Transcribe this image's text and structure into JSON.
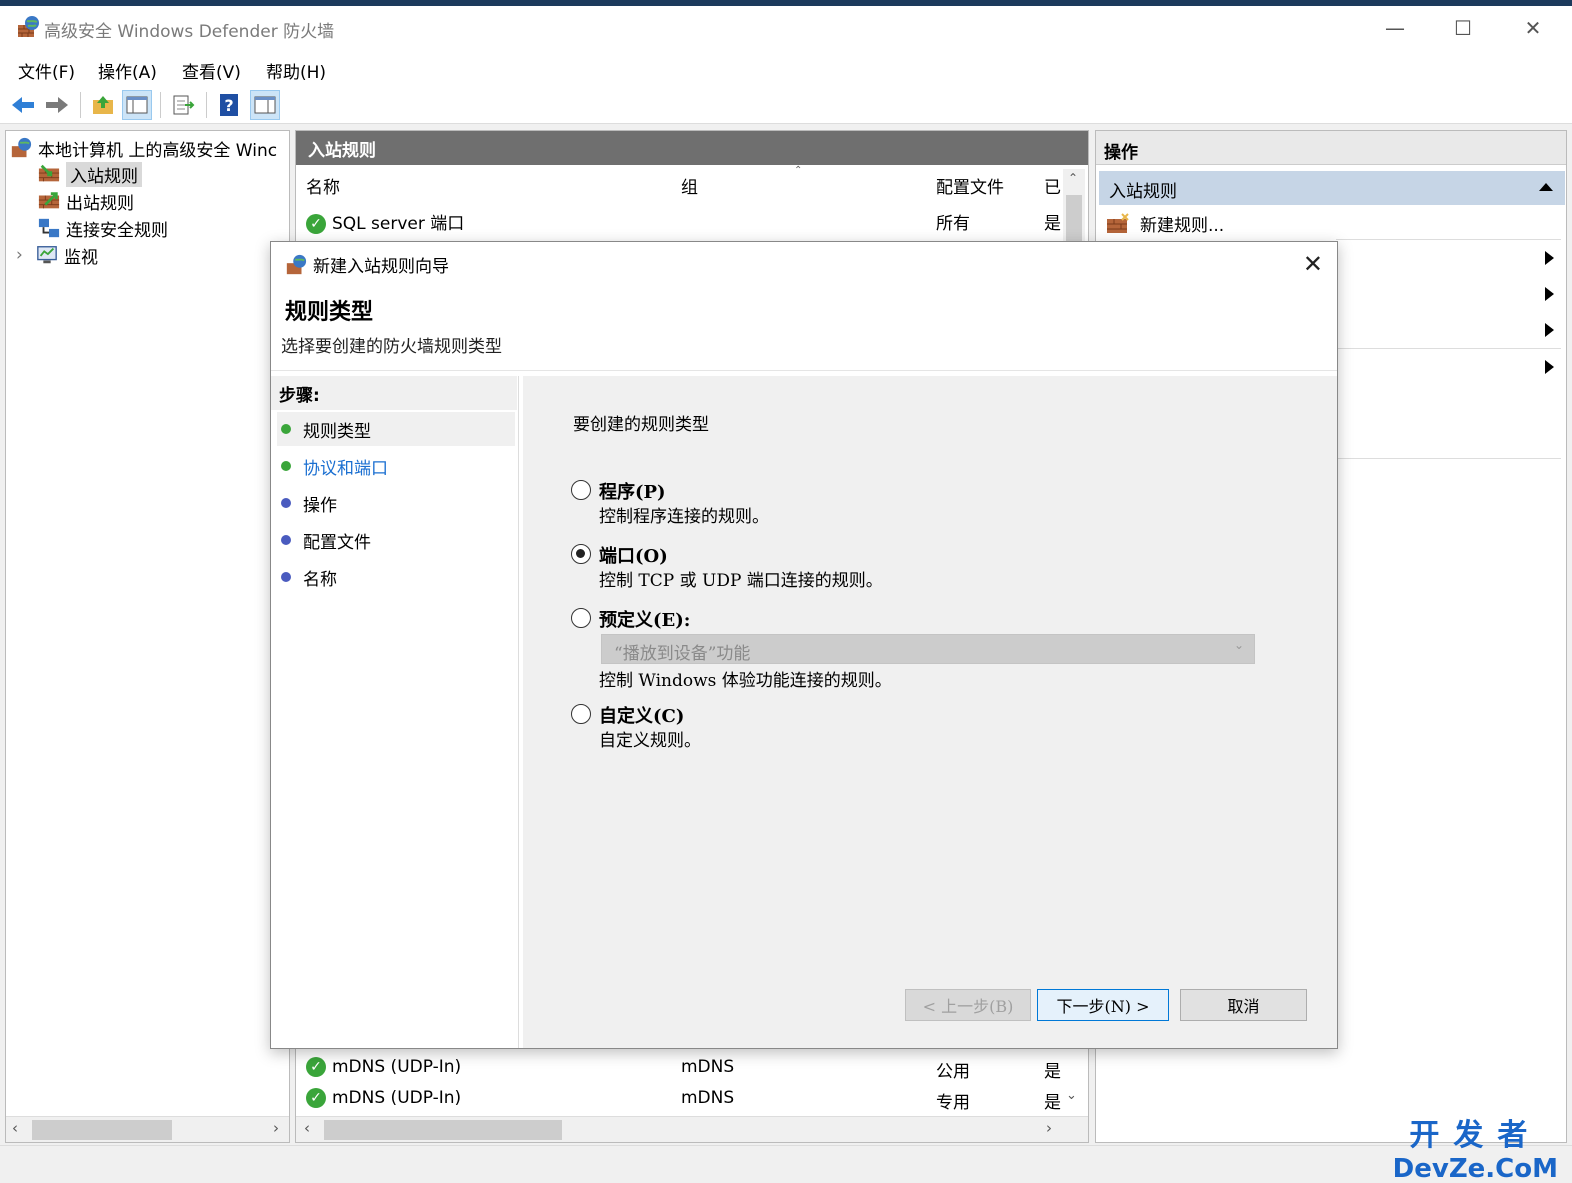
{
  "window": {
    "title": "高级安全 Windows Defender 防火墙",
    "minimize": "—",
    "maximize": "☐",
    "close": "✕"
  },
  "menu": [
    "文件(F)",
    "操作(A)",
    "查看(V)",
    "帮助(H)"
  ],
  "toolbar": {
    "buttons": [
      "back-arrow-icon",
      "forward-arrow-icon",
      "up-folder-icon",
      "show-hide-tree-icon",
      "export-list-icon",
      "help-icon",
      "show-hide-action-pane-icon"
    ]
  },
  "tree": {
    "root": "本地计算机 上的高级安全 Winc",
    "items": [
      "入站规则",
      "出站规则",
      "连接安全规则",
      "监视"
    ],
    "expander": "›"
  },
  "center": {
    "header": "入站规则",
    "columns": [
      "名称",
      "组",
      "配置文件",
      "已"
    ],
    "rows": [
      {
        "name": "SQL server 端口",
        "group": "",
        "profile": "所有",
        "enabled": "是"
      },
      {
        "name": "mDNS (UDP-In)",
        "group": "mDNS",
        "profile": "公用",
        "enabled": "是"
      },
      {
        "name": "mDNS (UDP-In)",
        "group": "mDNS",
        "profile": "专用",
        "enabled": "是"
      }
    ]
  },
  "actions": {
    "header": "操作",
    "section": "入站规则",
    "items": [
      "新建规则..."
    ]
  },
  "dialog": {
    "title": "新建入站规则向导",
    "heading": "规则类型",
    "subheading": "选择要创建的防火墙规则类型",
    "steps_label": "步骤:",
    "steps": [
      "规则类型",
      "协议和端口",
      "操作",
      "配置文件",
      "名称"
    ],
    "content_title": "要创建的规则类型",
    "options": [
      {
        "label": "程序(P)",
        "desc": "控制程序连接的规则。",
        "selected": false
      },
      {
        "label": "端口(O)",
        "desc": "控制 TCP 或 UDP 端口连接的规则。",
        "selected": true
      },
      {
        "label": "预定义(E):",
        "desc": "控制 Windows 体验功能连接的规则。",
        "selected": false
      },
      {
        "label": "自定义(C)",
        "desc": "自定义规则。",
        "selected": false
      }
    ],
    "predefined_value": "“播放到设备”功能",
    "buttons": {
      "back": "< 上一步(B)",
      "next": "下一步(N) >",
      "cancel": "取消"
    }
  },
  "watermark": {
    "line1": "开发者",
    "line2": "DevZe.CoM"
  },
  "colors": {
    "step_done": "#3aa53a",
    "step_todo": "#4a5bbf",
    "link": "#1a6fd1"
  }
}
